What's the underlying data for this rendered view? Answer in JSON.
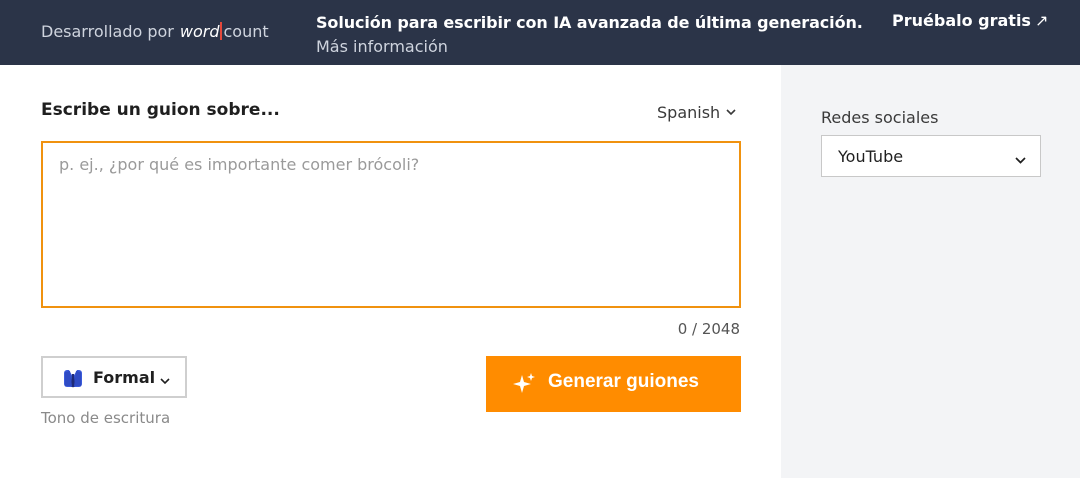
{
  "banner": {
    "powered_by": "Desarrollado por",
    "brand_word": "word",
    "brand_count": "count",
    "promo_line1": "Solución para escribir con IA avanzada de última generación.",
    "promo_line2": "Más información",
    "try_free": "Pruébalo gratis",
    "try_icon": "arrow-up-right-icon"
  },
  "main": {
    "heading": "Escribe un guion sobre...",
    "language": "Spanish",
    "topic_placeholder": "p. ej., ¿por qué es importante comer brócoli?",
    "topic_value": "",
    "counter": "0 / 2048",
    "tone_value": "Formal",
    "tone_icon": "formal-suit-icon",
    "tone_label": "Tono de escritura",
    "generate_label": "Generar guiones",
    "generate_icon": "sparkle-icon"
  },
  "side": {
    "label": "Redes sociales",
    "platform_value": "YouTube"
  },
  "colors": {
    "banner_bg": "#2b3448",
    "accent": "#ff8c00",
    "input_border": "#f0920f",
    "side_bg": "#f3f4f6"
  }
}
